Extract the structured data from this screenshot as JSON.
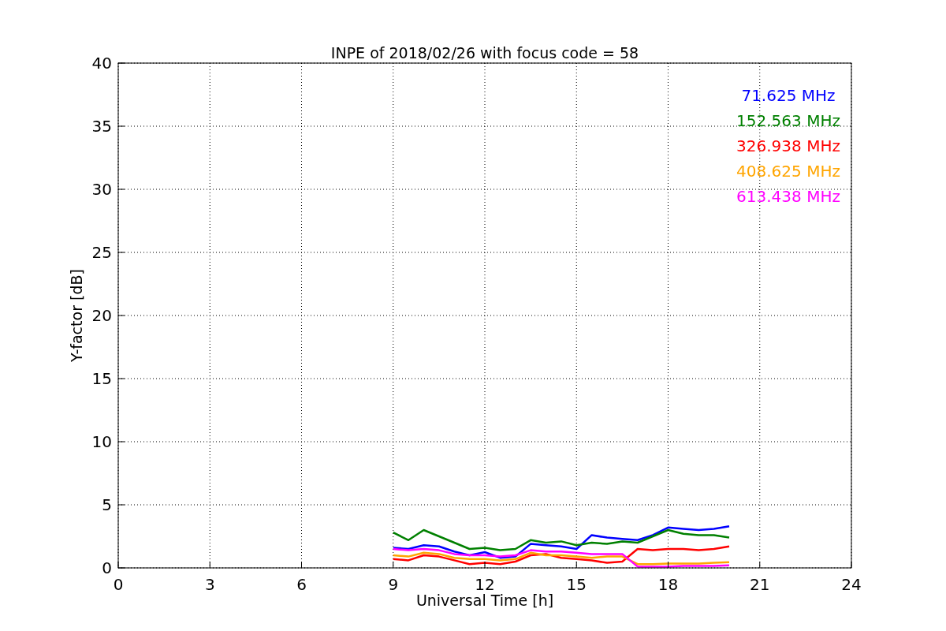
{
  "chart_data": {
    "type": "line",
    "title": "INPE of 2018/02/26 with focus code = 58",
    "xlabel": "Universal Time [h]",
    "ylabel": "Y-factor [dB]",
    "x": [
      9,
      9.5,
      10,
      10.5,
      11,
      11.5,
      12,
      12.5,
      13,
      13.5,
      14,
      14.5,
      15,
      15.5,
      16,
      16.5,
      17,
      17.5,
      18,
      18.5,
      19,
      19.5,
      20
    ],
    "series": [
      {
        "name": "71.625 MHz",
        "color": "#0000ff",
        "values": [
          1.6,
          1.5,
          1.8,
          1.7,
          1.3,
          1.0,
          1.25,
          0.8,
          0.9,
          1.9,
          1.8,
          1.7,
          1.5,
          2.6,
          2.4,
          2.3,
          2.2,
          2.6,
          3.2,
          3.1,
          3.0,
          3.1,
          3.3
        ]
      },
      {
        "name": "152.563 MHz",
        "color": "#008000",
        "values": [
          2.8,
          2.2,
          3.0,
          2.5,
          2.0,
          1.5,
          1.6,
          1.4,
          1.5,
          2.2,
          2.0,
          2.1,
          1.8,
          2.0,
          1.9,
          2.1,
          2.0,
          2.5,
          3.0,
          2.7,
          2.6,
          2.6,
          2.4
        ]
      },
      {
        "name": "326.938 MHz",
        "color": "#ff0000",
        "values": [
          0.7,
          0.6,
          1.0,
          0.9,
          0.6,
          0.3,
          0.4,
          0.3,
          0.5,
          1.0,
          1.1,
          0.8,
          0.7,
          0.6,
          0.4,
          0.5,
          1.5,
          1.4,
          1.5,
          1.5,
          1.4,
          1.5,
          1.7
        ]
      },
      {
        "name": "408.625 MHz",
        "color": "#ffa500",
        "values": [
          1.0,
          0.9,
          1.2,
          1.1,
          0.8,
          0.7,
          0.7,
          0.6,
          0.7,
          1.2,
          1.0,
          1.0,
          0.9,
          0.8,
          0.9,
          0.9,
          0.3,
          0.3,
          0.35,
          0.35,
          0.35,
          0.4,
          0.45
        ]
      },
      {
        "name": "613.438 MHz",
        "color": "#ff00ff",
        "values": [
          1.5,
          1.4,
          1.5,
          1.4,
          1.1,
          1.0,
          1.0,
          0.9,
          1.0,
          1.4,
          1.3,
          1.3,
          1.2,
          1.1,
          1.1,
          1.1,
          0.1,
          0.1,
          0.1,
          0.15,
          0.15,
          0.15,
          0.2
        ]
      }
    ],
    "grid": true,
    "xlim": [
      0,
      24
    ],
    "ylim": [
      0,
      40
    ],
    "xticks": [
      0,
      3,
      6,
      9,
      12,
      15,
      18,
      21,
      24
    ],
    "yticks": [
      0,
      5,
      10,
      15,
      20,
      25,
      30,
      35,
      40
    ]
  }
}
